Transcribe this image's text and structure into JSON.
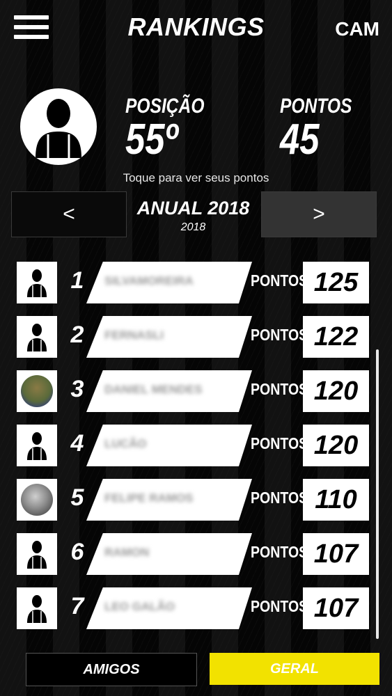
{
  "header": {
    "title": "RANKINGS",
    "team": "CAM"
  },
  "profile": {
    "position_label": "POSIÇÃO",
    "position_value": "55º",
    "points_label": "PONTOS",
    "points_value": "45",
    "hint": "Toque para ver seus pontos"
  },
  "period": {
    "prev": "<",
    "next": ">",
    "title": "ANUAL 2018",
    "year": "2018"
  },
  "ranking": {
    "points_label": "PONTOS",
    "rows": [
      {
        "rank": "1",
        "name": "SILVAMOREIRA",
        "points": "125",
        "avatar": "person-icon"
      },
      {
        "rank": "2",
        "name": "FERNASLI",
        "points": "122",
        "avatar": "person-icon"
      },
      {
        "rank": "3",
        "name": "DANIEL MENDES",
        "points": "120",
        "avatar": "photo"
      },
      {
        "rank": "4",
        "name": "LUCÃO",
        "points": "120",
        "avatar": "person-icon"
      },
      {
        "rank": "5",
        "name": "FELIPE RAMOS",
        "points": "110",
        "avatar": "photo"
      },
      {
        "rank": "6",
        "name": "RAMON",
        "points": "107",
        "avatar": "person-icon"
      },
      {
        "rank": "7",
        "name": "LEO GALÃO",
        "points": "107",
        "avatar": "person-icon"
      }
    ]
  },
  "tabs": {
    "friends": "AMIGOS",
    "general": "GERAL"
  },
  "colors": {
    "accent": "#f2e200",
    "background": "#0b0b0b"
  }
}
